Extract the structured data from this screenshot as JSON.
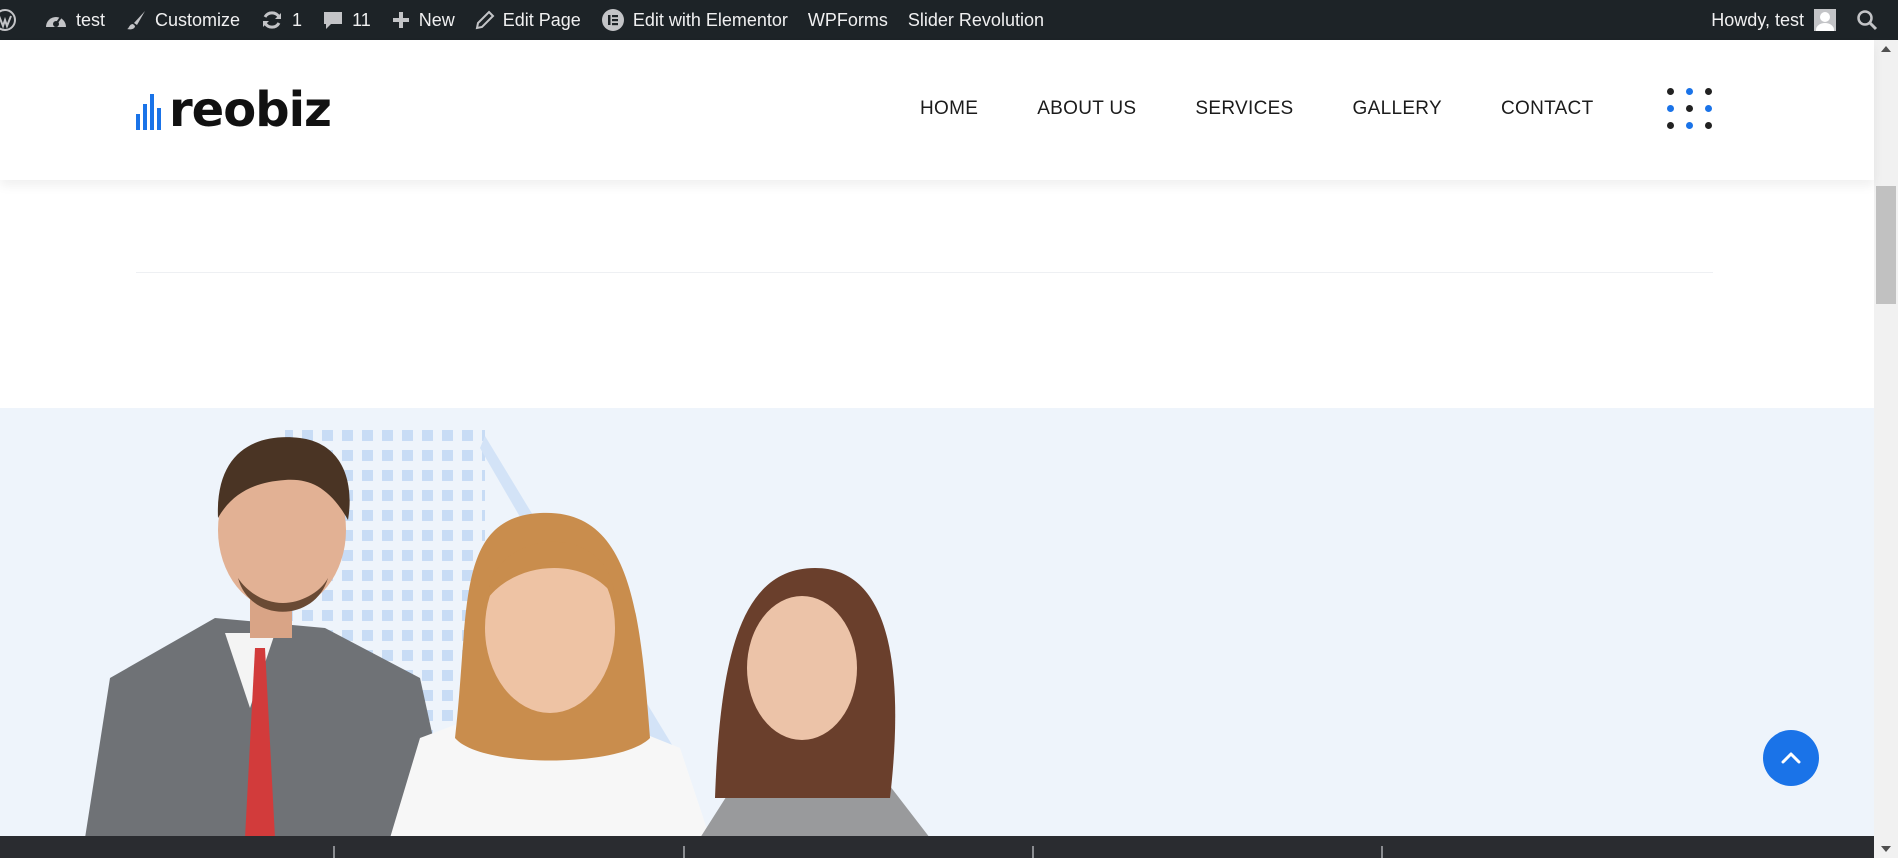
{
  "admin_bar": {
    "site_name": "test",
    "customize": "Customize",
    "updates_count": "1",
    "comments_count": "11",
    "new": "New",
    "edit_page": "Edit Page",
    "edit_elementor": "Edit with Elementor",
    "wpforms": "WPForms",
    "slider_revolution": "Slider Revolution",
    "howdy": "Howdy, test"
  },
  "header": {
    "logo_text": "reobiz",
    "nav": [
      "HOME",
      "ABOUT US",
      "SERVICES",
      "GALLERY",
      "CONTACT"
    ]
  },
  "icons": {
    "wordpress": "wordpress-icon",
    "dashboard": "dashboard-icon",
    "customize": "brush-icon",
    "updates": "refresh-icon",
    "comments": "comment-icon",
    "new": "plus-icon",
    "edit": "pencil-icon",
    "elementor": "elementor-icon",
    "search": "search-icon",
    "menu": "dots-grid-icon",
    "back_to_top": "chevron-up-icon"
  },
  "colors": {
    "admin_bar": "#1d2327",
    "accent": "#1a73e8",
    "hero_bg": "#eef4fb"
  }
}
